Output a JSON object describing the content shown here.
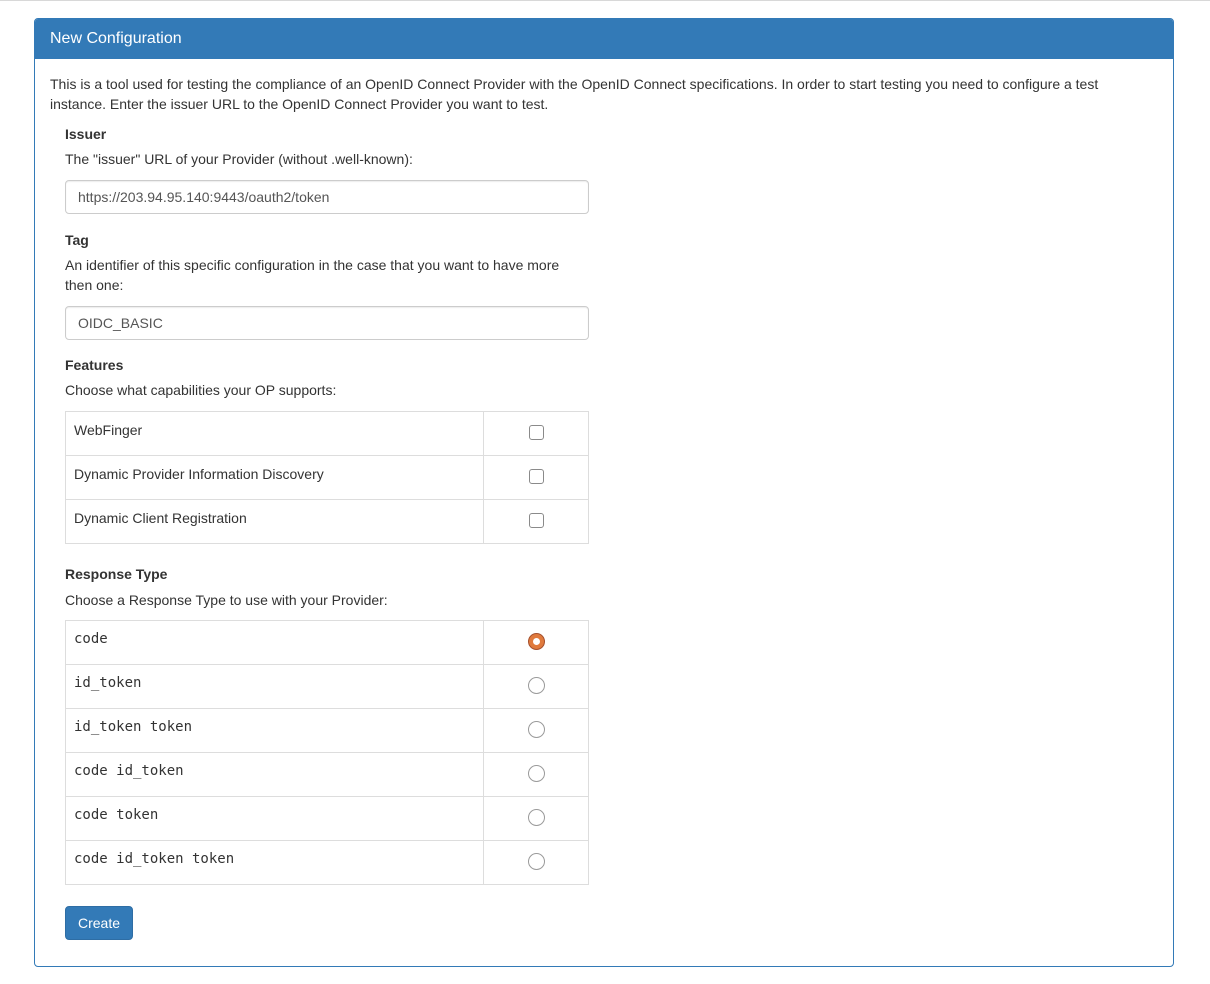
{
  "panel": {
    "title": "New Configuration",
    "intro": "This is a tool used for testing the compliance of an OpenID Connect Provider with the OpenID Connect specifications. In order to start testing you need to configure a test instance. Enter the issuer URL to the OpenID Connect Provider you want to test."
  },
  "issuer": {
    "label": "Issuer",
    "help": "The \"issuer\" URL of your Provider (without .well-known):",
    "value": "https://203.94.95.140:9443/oauth2/token"
  },
  "tag": {
    "label": "Tag",
    "help": "An identifier of this specific configuration in the case that you want to have more then one:",
    "value": "OIDC_BASIC"
  },
  "features": {
    "label": "Features",
    "help": "Choose what capabilities your OP supports:",
    "items": [
      {
        "label": "WebFinger",
        "checked": false
      },
      {
        "label": "Dynamic Provider Information Discovery",
        "checked": false
      },
      {
        "label": "Dynamic Client Registration",
        "checked": false
      }
    ]
  },
  "response_type": {
    "label": "Response Type",
    "help": "Choose a Response Type to use with your Provider:",
    "options": [
      {
        "label": "code",
        "selected": true
      },
      {
        "label": "id_token",
        "selected": false
      },
      {
        "label": "id_token token",
        "selected": false
      },
      {
        "label": "code id_token",
        "selected": false
      },
      {
        "label": "code token",
        "selected": false
      },
      {
        "label": "code id_token token",
        "selected": false
      }
    ]
  },
  "actions": {
    "create_label": "Create"
  },
  "colors": {
    "primary": "#337ab7",
    "radio_selected": "#e07a3d"
  }
}
